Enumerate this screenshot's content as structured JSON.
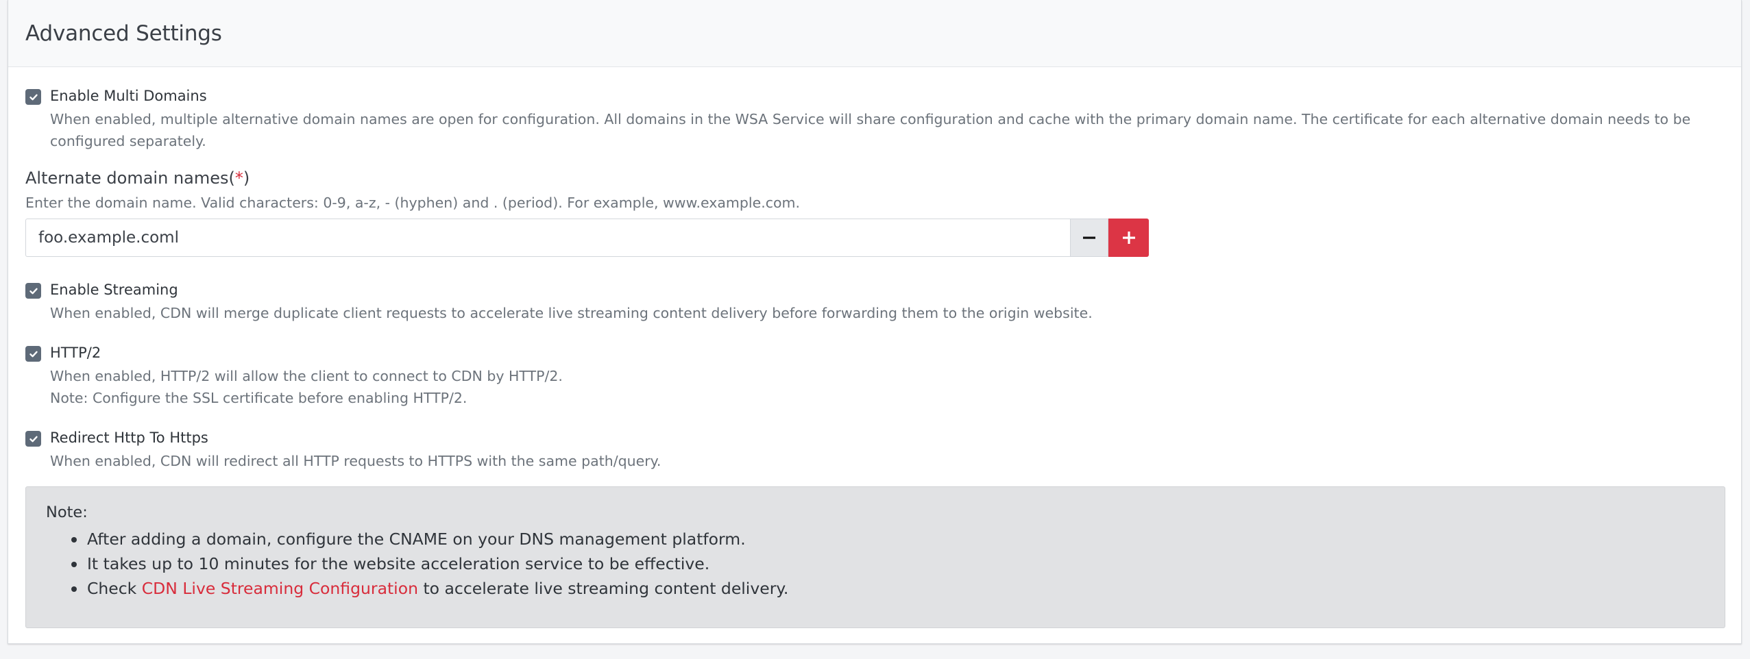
{
  "header": {
    "title": "Advanced Settings"
  },
  "multi_domains": {
    "label": "Enable Multi Domains",
    "checked": true,
    "description": "When enabled, multiple alternative domain names are open for configuration. All domains in the WSA Service will share configuration and cache with the primary domain name. The certificate for each alternative domain needs to be configured separately."
  },
  "alternate_domains": {
    "label": "Alternate domain names(",
    "required_mark": "*",
    "label_close": ")",
    "help": "Enter the domain name. Valid characters: 0-9, a-z, - (hyphen) and . (period). For example, www.example.com.",
    "value": "foo.example.coml"
  },
  "streaming": {
    "label": "Enable Streaming",
    "checked": true,
    "description": "When enabled, CDN will merge duplicate client requests to accelerate live streaming content delivery before forwarding them to the origin website."
  },
  "http2": {
    "label": "HTTP/2",
    "checked": true,
    "description": "When enabled, HTTP/2 will allow the client to connect to CDN by HTTP/2.",
    "note": "Note: Configure the SSL certificate before enabling HTTP/2."
  },
  "redirect": {
    "label": "Redirect Http To Https",
    "checked": true,
    "description": "When enabled, CDN will redirect all HTTP requests to HTTPS with the same path/query."
  },
  "note": {
    "title": "Note:",
    "item1": "After adding a domain, configure the CNAME on your DNS management platform.",
    "item2": "It takes up to 10 minutes for the website acceleration service to be effective.",
    "item3_prefix": "Check ",
    "item3_link": "CDN Live Streaming Configuration",
    "item3_suffix": " to accelerate live streaming content delivery."
  },
  "colors": {
    "accent": "#dc3545",
    "checkbox": "#5e6a78",
    "note_bg": "#e1e2e4"
  },
  "icons": {
    "checkbox": "check-icon",
    "remove": "minus-icon",
    "add": "plus-icon"
  }
}
